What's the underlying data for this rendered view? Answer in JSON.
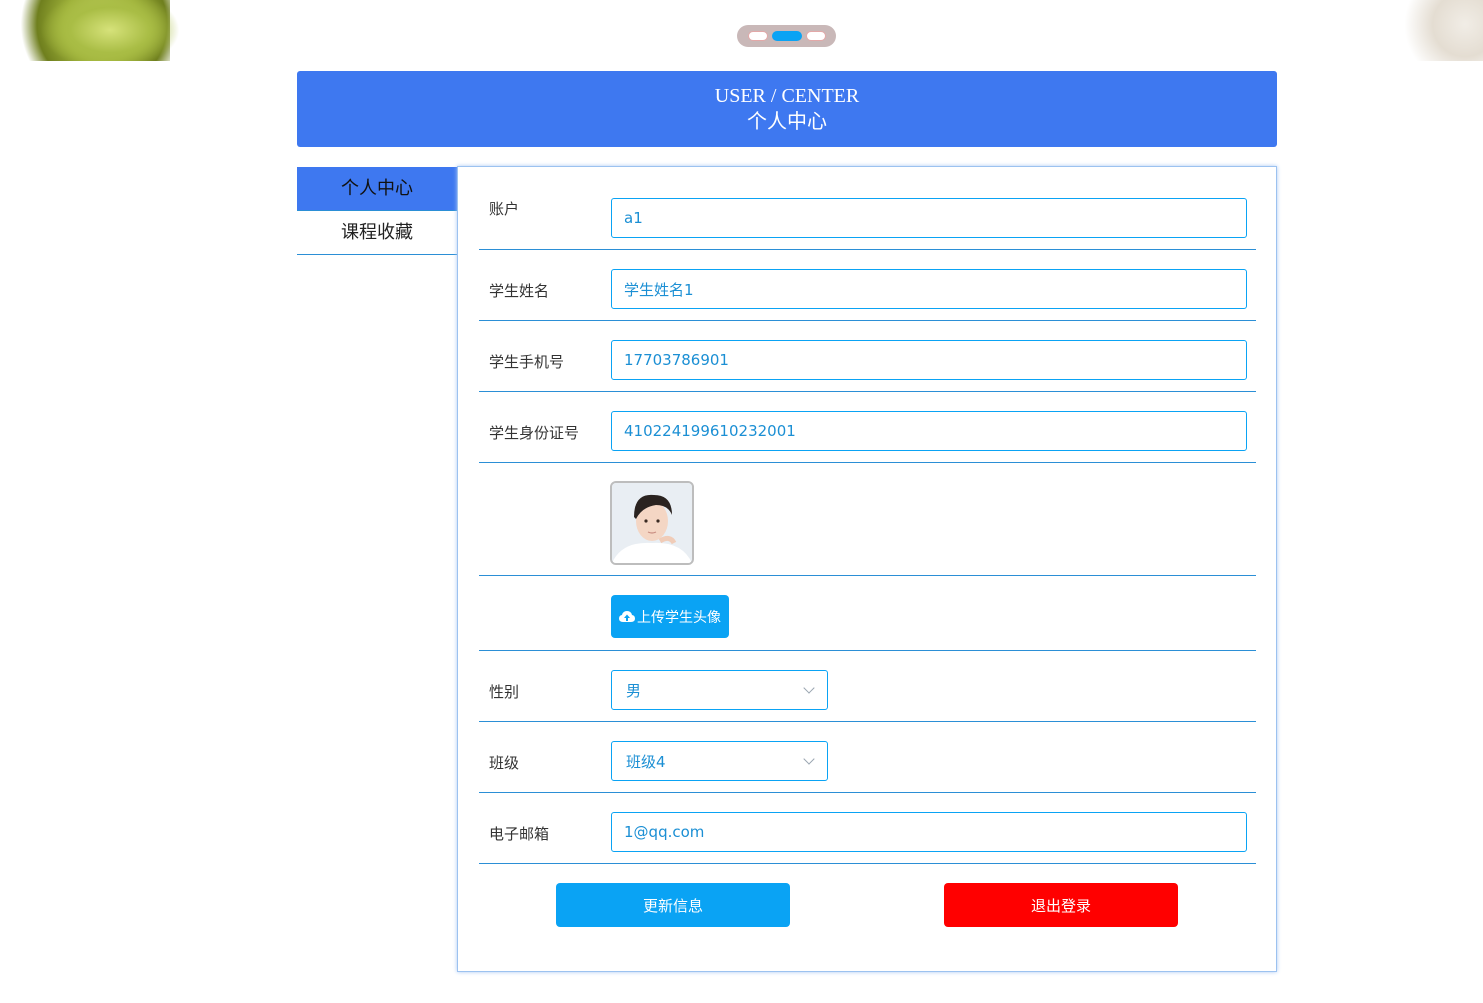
{
  "header": {
    "title_en": "USER / CENTER",
    "title_cn": "个人中心",
    "color": "#3e78f0"
  },
  "sidebar": {
    "items": [
      {
        "label": "个人中心",
        "active": true
      },
      {
        "label": "课程收藏",
        "active": false
      }
    ]
  },
  "carousel": {
    "count": 3,
    "active_index": 1
  },
  "form": {
    "account": {
      "label": "账户",
      "value": "a1"
    },
    "name": {
      "label": "学生姓名",
      "value": "学生姓名1"
    },
    "phone": {
      "label": "学生手机号",
      "value": "17703786901"
    },
    "id_number": {
      "label": "学生身份证号",
      "value": "410224199610232001"
    },
    "avatar": {
      "label": ""
    },
    "upload": {
      "label": "上传学生头像",
      "icon": "cloud-upload-icon"
    },
    "gender": {
      "label": "性别",
      "value": "男"
    },
    "class": {
      "label": "班级",
      "value": "班级4"
    },
    "email": {
      "label": "电子邮箱",
      "value": "1@qq.com"
    }
  },
  "actions": {
    "update_label": "更新信息",
    "update_color": "#0aa3f4",
    "logout_label": "退出登录",
    "logout_color": "#ff0000"
  }
}
